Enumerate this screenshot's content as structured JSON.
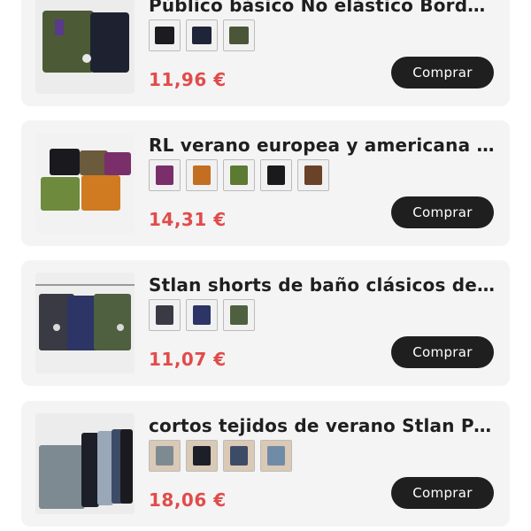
{
  "products": [
    {
      "title": "Público básico No elástico Bordado...",
      "price": "11,96 €",
      "buy_label": "Comprar",
      "photo_colors": [
        "#4d5a36",
        "#1e2230"
      ],
      "swatches": [
        "#1c1c20",
        "#1f2538",
        "#4b5538"
      ]
    },
    {
      "title": "RL verano europea y americana cort...",
      "price": "14,31 €",
      "buy_label": "Comprar",
      "photo_colors": [
        "#1a1a1e",
        "#6b5a3c",
        "#7a2e6a",
        "#6e8a3c",
        "#d07a22"
      ],
      "swatches": [
        "#7a2e6a",
        "#c46e22",
        "#5c7a32",
        "#1a1a1c",
        "#6a4228"
      ]
    },
    {
      "title": "Stlan shorts de baño clásicos de ver...",
      "price": "11,07 €",
      "buy_label": "Comprar",
      "photo_colors": [
        "#3a3a44",
        "#2c3566",
        "#4f6040"
      ],
      "swatches": [
        "#3a3a44",
        "#2c3566",
        "#4f6040"
      ]
    },
    {
      "title": "cortos tejidos de verano Stlan Panta...",
      "price": "18,06 €",
      "buy_label": "Comprar",
      "photo_colors": [
        "#7d8a92",
        "#1c1f28",
        "#9aa7b8",
        "#3c4c66"
      ],
      "swatches": [
        "#7d8a92",
        "#1c1f28",
        "#3c4c66",
        "#6f8ba8"
      ]
    }
  ]
}
